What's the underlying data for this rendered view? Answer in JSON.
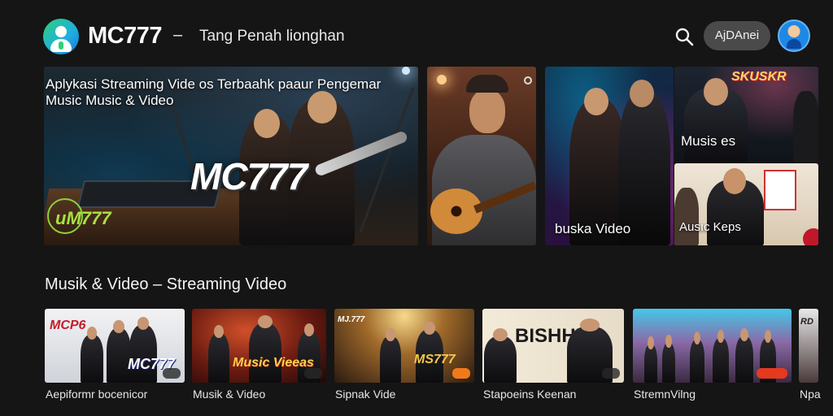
{
  "header": {
    "brand": "MC777",
    "dash": "–",
    "tagline": "Tang Penah lionghan",
    "pill_label": "AjDAnei"
  },
  "hero": {
    "title_line1": "Aplykasi Streaming Vide os Terbaahk paaur Pengemar",
    "title_line2": "Music Music & Video",
    "logo_text": "MC777",
    "badge_text": "иM777"
  },
  "side_cards": {
    "card3_label": "buska Video",
    "card4_label": "Musis es",
    "card4_sign": "SKUSKR",
    "card5_label": "Ausıc Keps"
  },
  "section": {
    "title": "Musik & Video  – Streaming Video"
  },
  "thumbnails": [
    {
      "label": "Aepiformr bocenicor",
      "overlay": "MC777"
    },
    {
      "label": "Musik & Video",
      "overlay": "Music Vieeas"
    },
    {
      "label": "Sipnak Vide",
      "overlay": "MS777"
    },
    {
      "label": "Stapoeins Keenan",
      "overlay": "BISHHI"
    },
    {
      "label": "StremnVilng",
      "overlay": ""
    },
    {
      "label": "Npa",
      "overlay": ""
    }
  ],
  "colors": {
    "background": "#151515",
    "pill": "#4a4a4a",
    "brand_gradient_start": "#2fd07a",
    "brand_gradient_end": "#1976d2",
    "badge_green": "#a8e040"
  },
  "icons": [
    "app-logo-icon",
    "search-icon",
    "avatar"
  ]
}
